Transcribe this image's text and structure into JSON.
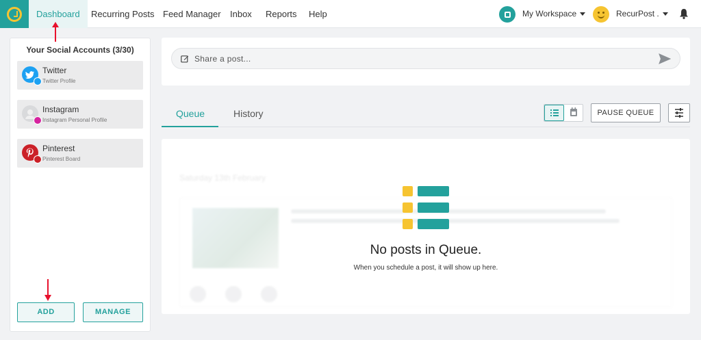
{
  "nav": {
    "items": [
      {
        "label": "Dashboard",
        "active": true
      },
      {
        "label": "Recurring Posts"
      },
      {
        "label": "Feed Manager"
      },
      {
        "label": "Inbox"
      },
      {
        "label": "Reports"
      },
      {
        "label": "Help"
      }
    ],
    "workspace_label": "My Workspace",
    "user_label": "RecurPost ."
  },
  "sidebar": {
    "title": "Your Social Accounts (3/30)",
    "accounts": [
      {
        "name": "Twitter",
        "type": "Twitter Profile",
        "icon": "twitter-icon",
        "color": "#1da1f2"
      },
      {
        "name": "Instagram",
        "type": "Instagram Personal Profile",
        "icon": "instagram-icon",
        "color": "#d6249f"
      },
      {
        "name": "Pinterest",
        "type": "Pinterest Board",
        "icon": "pinterest-icon",
        "color": "#cb2027"
      }
    ],
    "add_label": "ADD",
    "manage_label": "MANAGE"
  },
  "composer": {
    "placeholder": "Share a post..."
  },
  "tabs": {
    "queue_label": "Queue",
    "history_label": "History"
  },
  "toolbar": {
    "pause_label": "PAUSE QUEUE"
  },
  "queue": {
    "background_date": "Saturday 13th February",
    "empty_title": "No posts in Queue.",
    "empty_subtitle": "When you schedule a post, it will show up here."
  },
  "colors": {
    "accent": "#23a19c",
    "highlight": "#f6c431",
    "annotation": "#e8112d"
  }
}
